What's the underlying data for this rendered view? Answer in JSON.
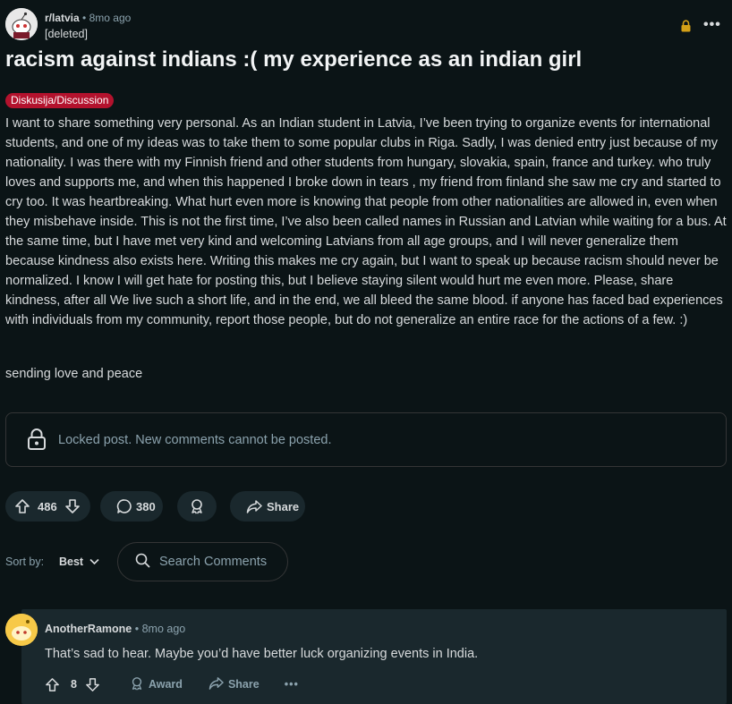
{
  "post": {
    "subreddit": "r/latvia",
    "separator": "•",
    "age": "8mo ago",
    "author": "[deleted]",
    "more": "•••",
    "title": "racism against indians :( my experience as an indian girl",
    "flair": "Diskusija/Discussion",
    "body": "I want to share something very personal. As an Indian student in Latvia, I’ve been trying to organize events for international students, and one of my ideas was to take them to some popular clubs in Riga. Sadly, I was denied entry just because of my nationality. I was there with my Finnish friend and other students from hungary, slovakia, spain, france and turkey. who truly loves and supports me, and when this happened I broke down in tears , my friend from finland she saw me cry and started to cry too. It was heartbreaking. What hurt even more is knowing that people from other nationalities are allowed in, even when they misbehave inside. This is not the first time, I’ve also been called names in Russian and Latvian while waiting for a bus. At the same time, but I have met very kind and welcoming Latvians from all age groups, and I will never generalize them because kindness also exists here. Writing this makes me cry again, but I want to speak up because racism should never be normalized. I know I will get hate for posting this, but I believe staying silent would hurt me even more. Please, share kindness, after all We live such a short life, and in the end, we all bleed the same blood. if anyone has faced bad experiences with individuals from my community, report those people, but do not generalize an entire race for the actions of a few. :)",
    "signoff": "sending love and peace",
    "locked_notice": "Locked post. New comments cannot be posted.",
    "score": "486",
    "comments": "380",
    "share_label": "Share"
  },
  "sort": {
    "label": "Sort by:",
    "value": "Best"
  },
  "search": {
    "placeholder": "Search Comments"
  },
  "comment": {
    "author": "AnotherRamone",
    "separator": "•",
    "age": "8mo ago",
    "text": "That’s sad to hear. Maybe you’d have better luck organizing events in India.",
    "score": "8",
    "award_label": "Award",
    "share_label": "Share",
    "more": "•••"
  },
  "colors": {
    "background": "#0b1416",
    "flair": "#b3122d",
    "lock_accent": "#d4a017",
    "pill": "#1a282d"
  },
  "icons": [
    "subreddit-avatar",
    "lock-icon",
    "upvote-icon",
    "downvote-icon",
    "comment-icon",
    "award-icon",
    "share-icon",
    "chevron-down-icon",
    "search-icon"
  ]
}
